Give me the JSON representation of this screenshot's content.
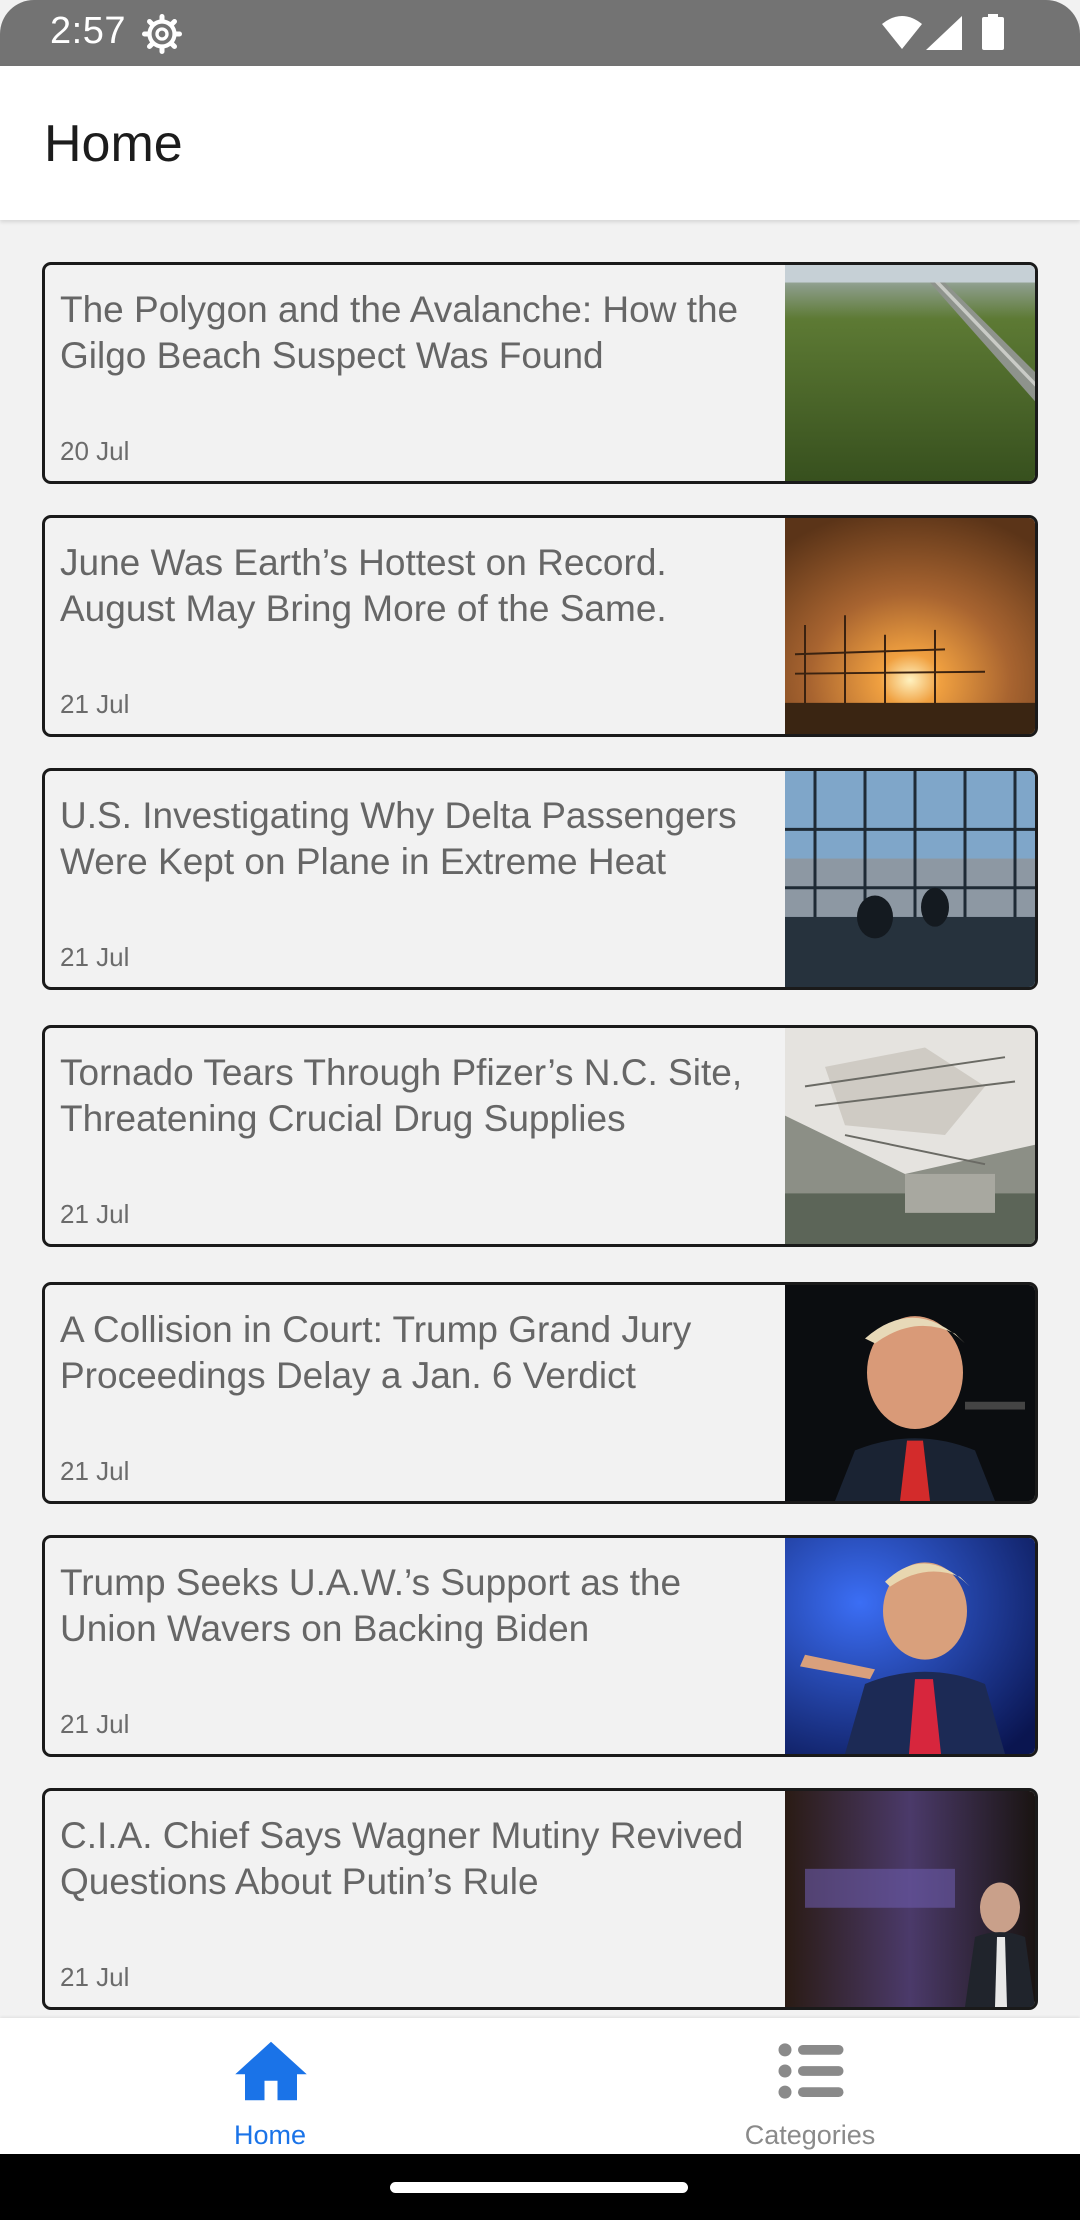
{
  "status_bar": {
    "time": "2:57",
    "icons": [
      "settings-gear-icon",
      "wifi-icon",
      "signal-icon",
      "battery-icon"
    ]
  },
  "app_bar": {
    "title": "Home"
  },
  "articles": [
    {
      "title": "The Polygon and the Avalanche: How the Gilgo Beach Suspect Was Found",
      "date": "20 Jul",
      "thumbnail": "aerial-marsh-highway-image"
    },
    {
      "title": "June Was Earth’s Hottest on Record. August May Bring More of the Same.",
      "date": "21 Jul",
      "thumbnail": "sunset-power-lines-image"
    },
    {
      "title": "U.S. Investigating Why Delta Passengers Were Kept on Plane in Extreme Heat",
      "date": "21 Jul",
      "thumbnail": "airport-terminal-window-image"
    },
    {
      "title": "Tornado Tears Through Pfizer’s N.C. Site, Threatening Crucial Drug Supplies",
      "date": "21 Jul",
      "thumbnail": "damaged-factory-aerial-image"
    },
    {
      "title": "A Collision in Court: Trump Grand Jury Proceedings Delay a Jan. 6 Verdict",
      "date": "21 Jul",
      "thumbnail": "trump-speaking-microphone-image"
    },
    {
      "title": "Trump Seeks U.A.W.’s Support as the Union Wavers on Backing Biden",
      "date": "21 Jul",
      "thumbnail": "trump-pointing-blue-stage-image"
    },
    {
      "title": "C.I.A. Chief Says Wagner Mutiny Revived Questions About Putin’s Rule",
      "date": "21 Jul",
      "thumbnail": "cia-chief-speaking-image"
    }
  ],
  "bottom_nav": {
    "items": [
      {
        "label": "Home",
        "icon": "home-icon",
        "active": true
      },
      {
        "label": "Categories",
        "icon": "list-icon",
        "active": false
      }
    ]
  },
  "colors": {
    "accent": "#1a73e8",
    "status_bar": "#737373",
    "background": "#f2f2f2",
    "card_border": "#1a1a1a",
    "inactive": "#8a8a8a"
  }
}
